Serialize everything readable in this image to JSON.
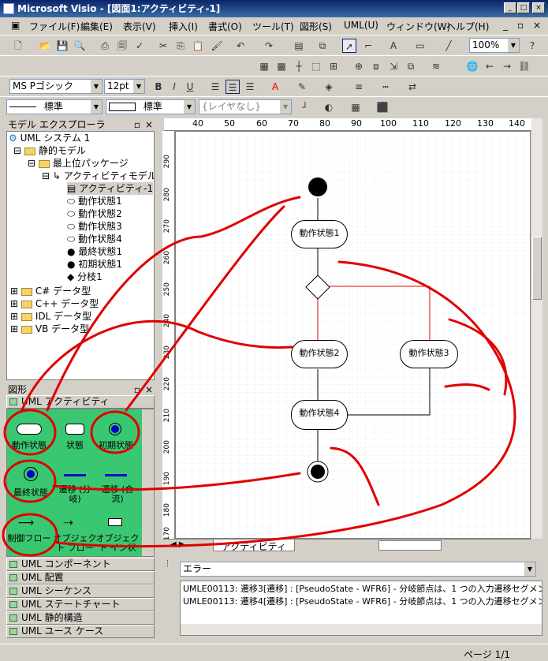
{
  "app": {
    "title": "Microsoft Visio - [図面1:アクティビティ-1]"
  },
  "menu": [
    "ファイル(F)",
    "編集(E)",
    "表示(V)",
    "挿入(I)",
    "書式(O)",
    "ツール(T)",
    "図形(S)",
    "UML(U)",
    "ウィンドウ(W)",
    "ヘルプ(H)"
  ],
  "toolbar": {
    "zoom": "100%",
    "font": "MS Pゴシック",
    "size": "12pt",
    "line_style": "標準",
    "fill_style": "標準",
    "layer": "{レイヤなし}"
  },
  "model_explorer": {
    "title": "モデル エクスプローラ",
    "items": [
      "UML システム 1",
      "静的モデル",
      "最上位パッケージ",
      "アクティビティモデル1",
      "アクティビティ-1",
      "動作状態1",
      "動作状態2",
      "動作状態3",
      "動作状態4",
      "最終状態1",
      "初期状態1",
      "分枝1",
      "C# データ型",
      "C++ データ型",
      "IDL データ型",
      "VB データ型"
    ]
  },
  "shapes": {
    "title": "図形",
    "stencil": "UML アクティビティ",
    "items": [
      "動作状態",
      "状態",
      "初期状態",
      "最終状態",
      "遷移 (分岐)",
      "遷移 (合流)",
      "制御フロー",
      "オブジェクト フロー",
      "オブジェクト イン状"
    ],
    "other_stencils": [
      "UML コンポーネント",
      "UML 配置",
      "UML シーケンス",
      "UML ステートチャート",
      "UML 静的構造",
      "UML ユース ケース"
    ]
  },
  "ruler": {
    "h": [
      "40",
      "50",
      "60",
      "70",
      "80",
      "90",
      "100",
      "110",
      "120",
      "130",
      "140"
    ],
    "v": [
      "290",
      "280",
      "270",
      "260",
      "250",
      "240",
      "230",
      "220",
      "210",
      "200",
      "190",
      "180",
      "170"
    ]
  },
  "diagram": {
    "states": [
      "動作状態1",
      "動作状態2",
      "動作状態3",
      "動作状態4"
    ]
  },
  "page_tab": "アクティビティ",
  "errors": {
    "label": "エラー",
    "lines": [
      "UMLE00113:  遷移3[遷移] : [PseudoState - WFR6] - 分岐節点は、1 つの入力遷移セグメン",
      "UMLE00113:  遷移4[遷移] : [PseudoState - WFR6] - 分岐節点は、1 つの入力遷移セグメン"
    ]
  },
  "status": {
    "page": "ページ 1/1"
  },
  "colors": {
    "title_bar": "#0a246a",
    "shapes_bg": "#3ac771",
    "annotation": "#e00000"
  }
}
